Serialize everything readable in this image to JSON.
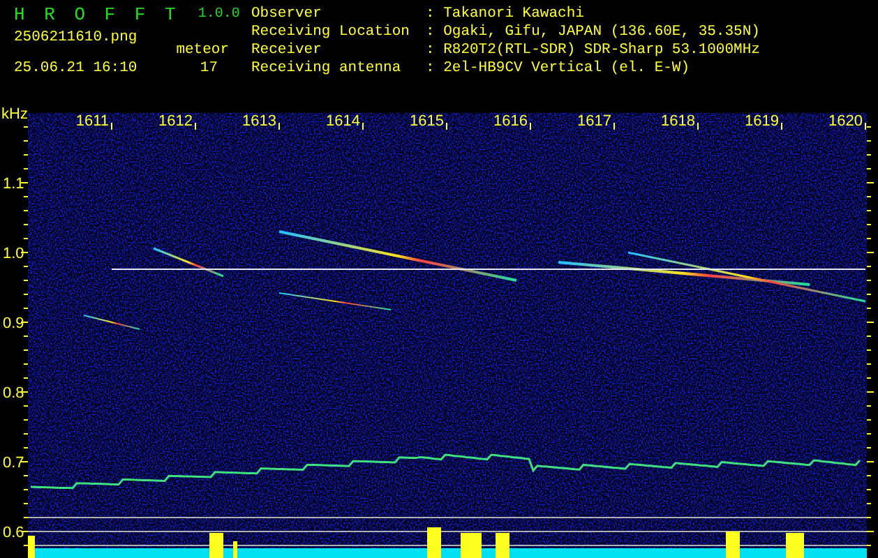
{
  "app": {
    "title": "H R O F F T",
    "version": "1.0.0"
  },
  "file_name": "2506211610.png",
  "meteor_label": "meteor",
  "date_time": "25.06.21 16:10",
  "meteor_count": "17",
  "info": [
    {
      "label": "Observer",
      "value": ": Takanori Kawachi"
    },
    {
      "label": "Receiving Location",
      "value": ": Ogaki, Gifu, JAPAN (136.60E, 35.35N)"
    },
    {
      "label": "Receiver",
      "value": ": R820T2(RTL-SDR) SDR-Sharp 53.1000MHz"
    },
    {
      "label": "Receiving antenna",
      "value": ": 2el-HB9CV Vertical (el. E-W)"
    }
  ],
  "spectrogram": {
    "y_unit": "kHz",
    "x_ticks": [
      "1611",
      "1612",
      "1613",
      "1614",
      "1615",
      "1616",
      "1617",
      "1618",
      "1619",
      "1620"
    ],
    "y_ticks": [
      "1.1",
      "1.0",
      "0.9",
      "0.8",
      "0.7",
      "0.6"
    ]
  }
}
